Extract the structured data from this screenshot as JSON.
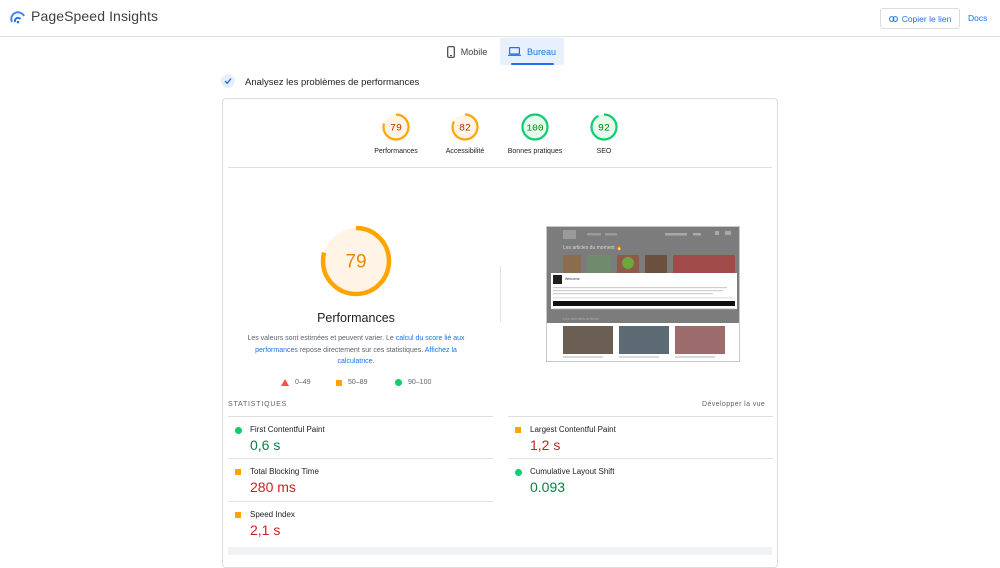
{
  "header": {
    "app_title": "PageSpeed Insights",
    "copy_label": "Copier le lien",
    "docs_label": "Docs"
  },
  "tabs": [
    {
      "label": "Mobile",
      "icon": "smartphone-icon",
      "selected": false
    },
    {
      "label": "Bureau",
      "icon": "laptop-icon",
      "selected": true
    }
  ],
  "section": {
    "title": "Analysez les problèmes de performances"
  },
  "scores": [
    {
      "value": "79",
      "label": "Performances",
      "color": "#ffa400"
    },
    {
      "value": "82",
      "label": "Accessibilité",
      "color": "#ffa400"
    },
    {
      "value": "100",
      "label": "Bonnes pratiques",
      "color": "#0cce6b"
    },
    {
      "value": "92",
      "label": "SEO",
      "color": "#0cce6b"
    }
  ],
  "performance": {
    "score": "79",
    "title": "Performances",
    "desc_1": "Les valeurs sont estimées et peuvent varier. Le ",
    "link_1": "calcul du score lié aux performances",
    "desc_2": " repose directement sur ces statistiques. ",
    "link_2": "Affichez la calculatrice",
    "desc_3": "."
  },
  "legend": {
    "fail": "0–49",
    "average": "50–89",
    "pass": "90–100"
  },
  "statistics": {
    "title": "STATISTIQUES",
    "expand_label": "Développer la vue",
    "metrics": [
      {
        "name": "First Contentful Paint",
        "value": "0,6 s",
        "status": "pass"
      },
      {
        "name": "Largest Contentful Paint",
        "value": "1,2 s",
        "status": "average"
      },
      {
        "name": "Total Blocking Time",
        "value": "280 ms",
        "status": "average"
      },
      {
        "name": "Cumulative Layout Shift",
        "value": "0.093",
        "status": "pass"
      },
      {
        "name": "Speed Index",
        "value": "2,1 s",
        "status": "average"
      }
    ]
  },
  "thumbnail": {
    "headline": "Les articles du moment 🔥",
    "modal_title": "Welcome",
    "section_2": "Les derniers articles"
  },
  "colors": {
    "accent": "#1a73e8",
    "pass": "#0cce6b",
    "average": "#ffa400",
    "fail": "#ff4e42"
  }
}
